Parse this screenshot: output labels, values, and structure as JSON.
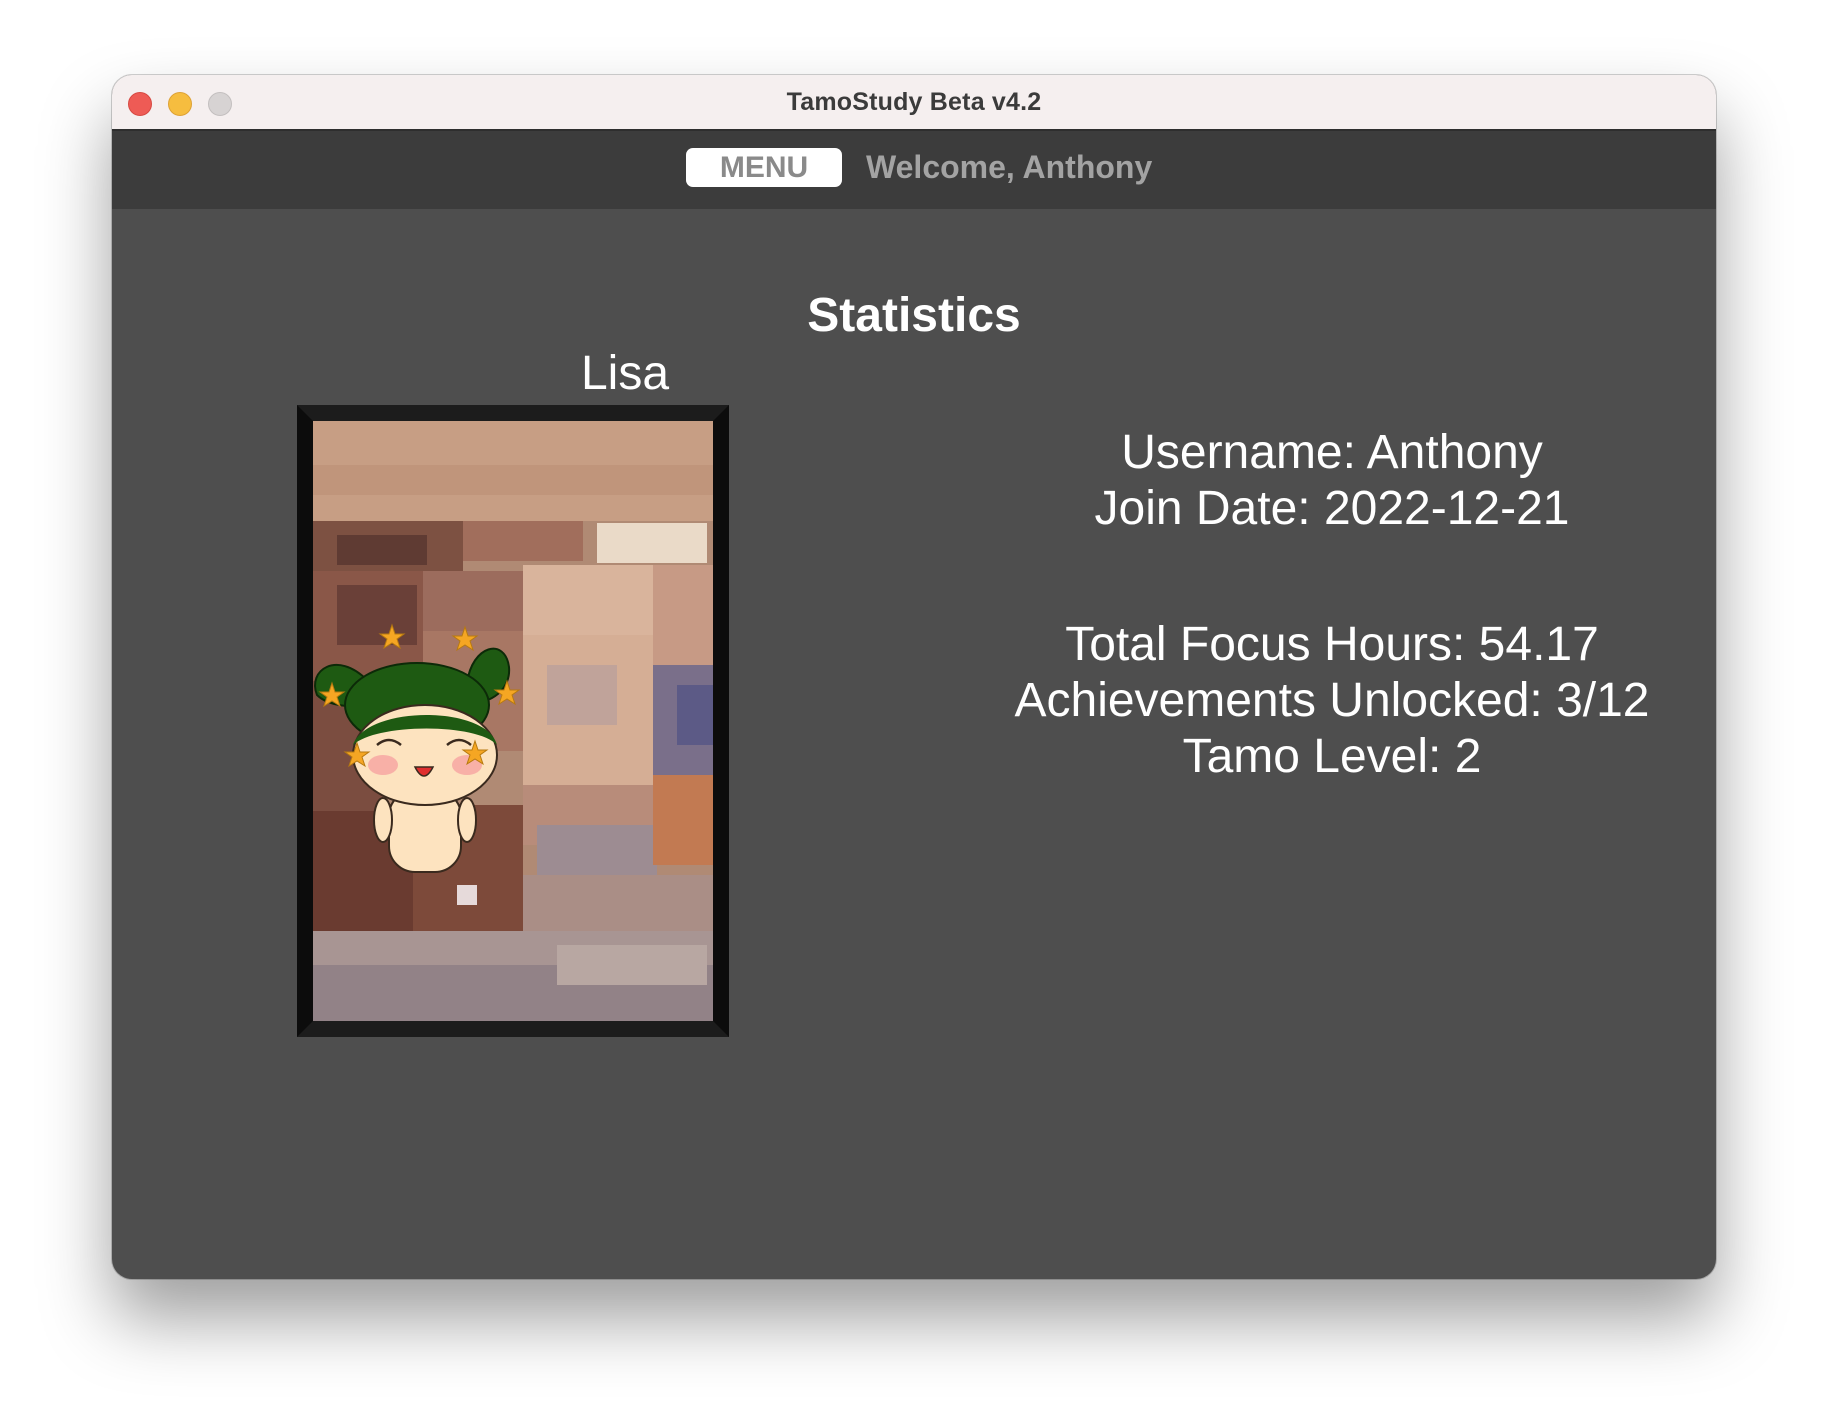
{
  "window": {
    "title": "TamoStudy Beta v4.2"
  },
  "topbar": {
    "menu_label": "MENU",
    "welcome_text": "Welcome, Anthony"
  },
  "page": {
    "heading": "Statistics"
  },
  "pet": {
    "name": "Lisa"
  },
  "stats": {
    "username": "Username: Anthony",
    "join_date": "Join Date: 2022-12-21",
    "total_focus_hours": "Total Focus Hours: 54.17",
    "achievements": "Achievements Unlocked: 3/12",
    "tamo_level": "Tamo Level: 2"
  },
  "colors": {
    "window_bg": "#4e4e4e",
    "topbar_bg": "#3c3c3c",
    "titlebar_bg": "#f5efef",
    "pet_hat": "#1e5a12",
    "pet_body": "#fde3bf",
    "star": "#f5a623"
  }
}
